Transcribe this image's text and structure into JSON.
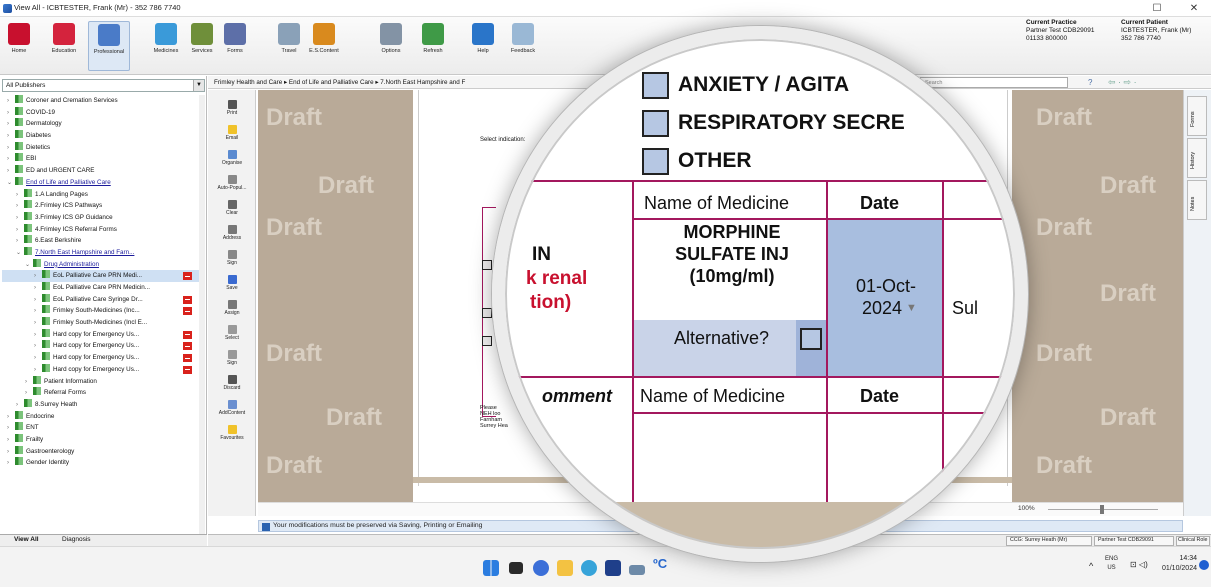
{
  "title": "View All  -  ICBTESTER, Frank (Mr)  -  352 786 7740",
  "window_controls": {
    "minimize": "–",
    "restore": "☐",
    "close": "✕"
  },
  "ribbon": [
    {
      "label": "Home",
      "color": "#c8102e"
    },
    {
      "label": "Education",
      "color": "#d4233d"
    },
    {
      "label": "Professional",
      "color": "#4a7bc8"
    },
    {
      "label": "Medicines",
      "color": "#3a9ad9"
    },
    {
      "label": "Services",
      "color": "#6f8f3a"
    },
    {
      "label": "Forms",
      "color": "#5d6fa8"
    },
    {
      "label": "Travel",
      "color": "#8aa1b8"
    },
    {
      "label": "E.S.Content",
      "color": "#d98a1e"
    },
    {
      "label": "Options",
      "color": "#8393a5"
    },
    {
      "label": "Refresh",
      "color": "#3f9a47"
    },
    {
      "label": "Help",
      "color": "#2a75c9"
    },
    {
      "label": "Feedback",
      "color": "#9ab8d5"
    }
  ],
  "current_practice": {
    "heading": "Current Practice",
    "name": "Partner Test CDB29091",
    "phone": "01133 800000"
  },
  "current_patient": {
    "heading": "Current Patient",
    "name": "ICBTESTER, Frank (Mr)",
    "phone": "352 786 7740"
  },
  "publisher_select": "All Publishers",
  "breadcrumb": "Frimley Health and Care  ▸  End of Life and Palliative Care  ▸  7.North East Hampshire and F",
  "search_placeholder": "Search",
  "tree": [
    {
      "label": "Coroner and Cremation Services",
      "indent": 1
    },
    {
      "label": "COVID-19",
      "indent": 1
    },
    {
      "label": "Dermatology",
      "indent": 1
    },
    {
      "label": "Diabetes",
      "indent": 1
    },
    {
      "label": "Dietetics",
      "indent": 1
    },
    {
      "label": "EBI",
      "indent": 1
    },
    {
      "label": "ED and URGENT CARE",
      "indent": 1
    },
    {
      "label": "End of Life and Palliative Care",
      "indent": 1,
      "link": true,
      "open": true
    },
    {
      "label": "1.A Landing Pages",
      "indent": 2
    },
    {
      "label": "2.Frimley ICS Pathways",
      "indent": 2
    },
    {
      "label": "3.Frimley ICS GP Guidance",
      "indent": 2
    },
    {
      "label": "4.Frimley ICS Referral Forms",
      "indent": 2
    },
    {
      "label": "6.East Berkshire",
      "indent": 2
    },
    {
      "label": "7.North East Hampshire and Farn...",
      "indent": 2,
      "link": true,
      "open": true
    },
    {
      "label": "Drug Administration",
      "indent": 3,
      "link": true,
      "open": true
    },
    {
      "label": "EoL Palliative Care PRN Medi...",
      "indent": 4,
      "sel": true,
      "red": true
    },
    {
      "label": "EoL Palliative Care PRN Medicin...",
      "indent": 4
    },
    {
      "label": "EoL Palliative Care Syringe Dr...",
      "indent": 4,
      "red": true
    },
    {
      "label": "Frimley South-Medicines (Inc...",
      "indent": 4,
      "red": true
    },
    {
      "label": "Frimley South-Medicines (Incl E...",
      "indent": 4
    },
    {
      "label": "Hard copy for Emergency Us...",
      "indent": 4,
      "red": true
    },
    {
      "label": "Hard copy for Emergency Us...",
      "indent": 4,
      "red": true
    },
    {
      "label": "Hard copy for Emergency Us...",
      "indent": 4,
      "red": true
    },
    {
      "label": "Hard copy for Emergency Us...",
      "indent": 4,
      "red": true
    },
    {
      "label": "Patient Information",
      "indent": 3
    },
    {
      "label": "Referral Forms",
      "indent": 3
    },
    {
      "label": "8.Surrey Heath",
      "indent": 2
    },
    {
      "label": "Endocrine",
      "indent": 1
    },
    {
      "label": "ENT",
      "indent": 1
    },
    {
      "label": "Frailty",
      "indent": 1
    },
    {
      "label": "Gastroenterology",
      "indent": 1
    },
    {
      "label": "Gender Identity",
      "indent": 1
    }
  ],
  "bottom_tabs": {
    "view_all": "View All",
    "diagnosis": "Diagnosis"
  },
  "side_tools": [
    "Print",
    "Email",
    "Organise",
    "Auto-Popul...",
    "Clear",
    "Address",
    "Sign",
    "Save",
    "Assign",
    "Select",
    "Sign",
    "Discard",
    "AddContent",
    "Favourites"
  ],
  "right_tabs": [
    "Forms",
    "History",
    "Notes"
  ],
  "draft_label": "Draft",
  "form_small": {
    "select_indication": "Select indication:",
    "please": "Please",
    "neh": "NEH loo",
    "farnham": "Farnham",
    "surrey": "Surrey Hea"
  },
  "lens": {
    "anxiety": "ANXIETY / AGITA",
    "resp": "RESPIRATORY SECRE",
    "other": "OTHER",
    "name_of_medicine": "Name of Medicine",
    "date": "Date",
    "med_line1": "MORPHINE",
    "med_line2": "SULFATE INJ",
    "med_line3": "(10mg/ml)",
    "date_value_1": "01-Oct-",
    "date_value_2": "2024",
    "sub": "Sul",
    "alternative": "Alternative?",
    "left_in": "IN",
    "left_renal": "k renal",
    "left_tion": "tion)",
    "comment": "omment",
    "name_of_medicine_2": "Name of Medicine",
    "date_2": "Date"
  },
  "zoom": "100%",
  "notice": "Your modifications must be preserved via Saving, Printing or Emailing",
  "status": {
    "ccg": "CCG: Surrey Heath (Mr)",
    "practice": "Partner Test CDB29091",
    "role": "Clinical Role"
  },
  "tray": {
    "lang1": "ENG",
    "lang2": "US",
    "time": "14:34",
    "date": "01/10/2024"
  }
}
